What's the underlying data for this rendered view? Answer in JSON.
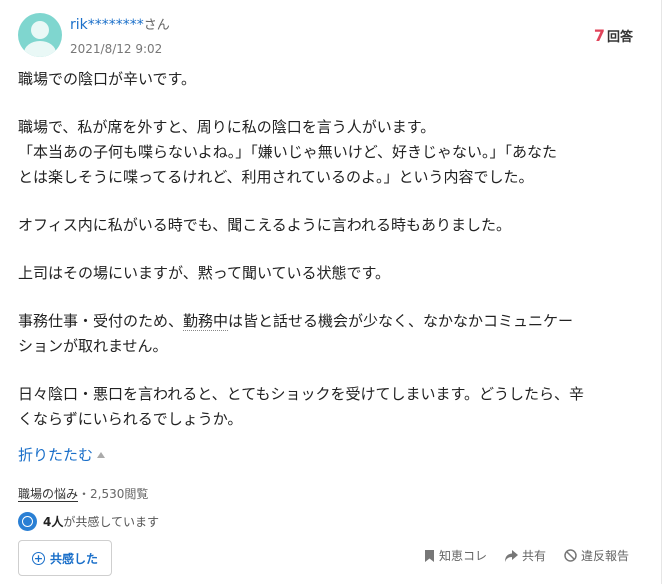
{
  "user": {
    "name": "rik********",
    "honorific": "さん",
    "date": "2021/8/12 9:02"
  },
  "answers": {
    "count": "7",
    "label": "回答"
  },
  "question": {
    "title": "職場での陰口が辛いです。",
    "p1_line1": "職場で、私が席を外すと、周りに私の陰口を言う人がいます。",
    "p1_line2": "「本当あの子何も喋らないよね。」「嫌いじゃ無いけど、好きじゃない。」「あなた",
    "p1_line3": "とは楽しそうに喋ってるけれど、利用されているのよ。」という内容でした。",
    "p2": "オフィス内に私がいる時でも、聞こえるように言われる時もありました。",
    "p3": "上司はその場にいますが、黙って聞いている状態です。",
    "p4_pre": "事務仕事・受付のため、",
    "p4_link": "勤務中",
    "p4_post": "は皆と話せる機会が少なく、なかなかコミュニケー",
    "p4_line2": "ションが取れません。",
    "p5_line1": "日々陰口・悪口を言われると、とてもショックを受けてしまいます。どうしたら、辛",
    "p5_line2": "くならずにいられるでしょうか。"
  },
  "fold_label": "折りたたむ",
  "meta": {
    "category": "職場の悩み",
    "views": "・2,530閲覧"
  },
  "empathy": {
    "count": "4人",
    "text": "が共感しています",
    "button_label": "共感した"
  },
  "actions": {
    "chiebukuro": "知恵コレ",
    "share": "共有",
    "report": "違反報告"
  },
  "colors": {
    "link": "#1a6fc9",
    "accent_number": "#e0445a",
    "avatar": "#7fd6cf"
  }
}
